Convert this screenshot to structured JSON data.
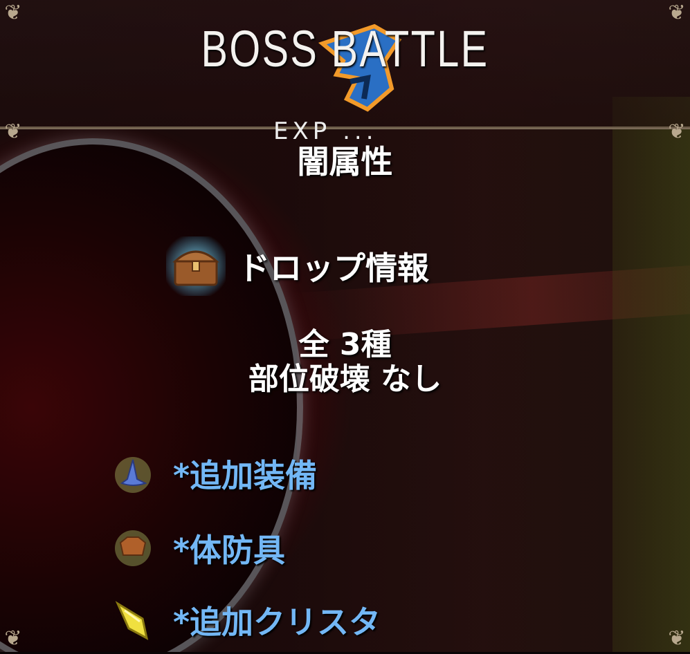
{
  "header": {
    "title": "BOSS BATTLE"
  },
  "boss": {
    "partial_text": "EXP ...",
    "attribute": "闇属性"
  },
  "drop_info": {
    "label": "ドロップ情報",
    "count": "全  3種",
    "part_break": "部位破壊  なし",
    "items": [
      {
        "label": "*追加装備",
        "icon": "wizard-hat-icon"
      },
      {
        "label": "*体防具",
        "icon": "body-armor-icon"
      },
      {
        "label": "*追加クリスタ",
        "icon": "crystal-icon"
      }
    ]
  },
  "colors": {
    "item_text": "#73b7f5",
    "frame": "#8a7a66"
  }
}
